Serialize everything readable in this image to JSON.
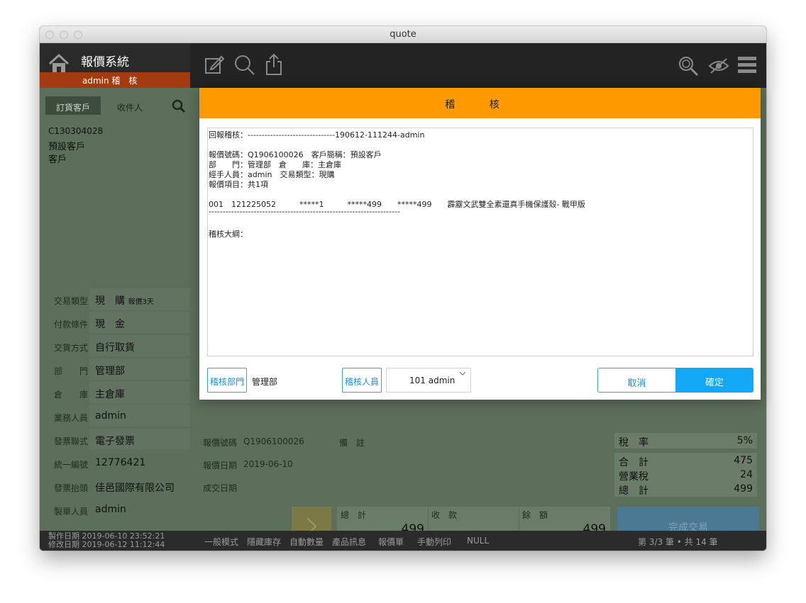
{
  "window": {
    "title": "quote"
  },
  "header": {
    "app_title": "報價系統",
    "user_line": "admin 稽　核"
  },
  "sidebar": {
    "tabs": [
      {
        "label": "訂貨客戶"
      },
      {
        "label": "收件人"
      }
    ],
    "customer": {
      "code": "C130304028",
      "name": "預設客戶",
      "type": "客戶"
    },
    "fields": [
      {
        "label": "交易類型",
        "value": "現　購",
        "note": "報價3天"
      },
      {
        "label": "付款條件",
        "value": "現　金"
      },
      {
        "label": "交貨方式",
        "value": "自行取貨"
      },
      {
        "label": "部　　門",
        "value": "管理部"
      },
      {
        "label": "倉　　庫",
        "value": "主倉庫"
      },
      {
        "label": "業務人員",
        "value": "admin"
      },
      {
        "label": "發票聯式",
        "value": "電子發票"
      },
      {
        "label": "統一編號",
        "value": "12776421"
      },
      {
        "label": "發票抬頭",
        "value": "佳邑國際有限公司"
      },
      {
        "label": "製單人員",
        "value": "admin"
      }
    ]
  },
  "main": {
    "quote_no_label": "報價號碼",
    "quote_no": "Q1906100026",
    "remark_label": "備　註",
    "quote_date_label": "報價日期",
    "quote_date": "2019-06-10",
    "deal_date_label": "成交日期",
    "tax_label": "稅　率",
    "tax_value": "5%",
    "subtotal_label": "合　計",
    "subtotal": "475",
    "vat_label": "營業稅",
    "vat": "24",
    "total_label": "總　計",
    "total": "499",
    "bottom_total_label": "總　計",
    "bottom_total": "499",
    "received_label": "收　款",
    "balance_label": "餘　額",
    "balance": "499",
    "complete_label": "完成交易"
  },
  "status": {
    "created": "製作日期  2019-06-10  23:52:21",
    "modified": "修改日期  2019-06-12  11:12:44",
    "menu": [
      "一般模式",
      "隱藏庫存",
      "自動數量",
      "產品訊息",
      "報價單",
      "手動列印",
      "NULL"
    ],
    "record": "第 3/3 筆 • 共 14 筆"
  },
  "modal": {
    "title": "稽 核",
    "report_lines": [
      "回報稽核：-------------------------------190612-111244-admin",
      "",
      "報價號碼：Q1906100026　客戶簡稱：預設客戶",
      "部　　門：管理部　倉　　庫：主倉庫",
      "經手人員：admin　交易類型：現購",
      "報價項目：共1項",
      "",
      "001　121225052　　　*****1　　　*****499　　*****499　　霹靂文武雙全素還真手機保護殼- 戰甲版",
      "--------------------------------------------------------------------",
      "",
      "",
      "稽核大綱："
    ],
    "dept_button": "稽核部門",
    "dept_value": "管理部",
    "staff_button": "稽核人員",
    "staff_value": "101 admin",
    "cancel": "取消",
    "confirm": "確定"
  }
}
